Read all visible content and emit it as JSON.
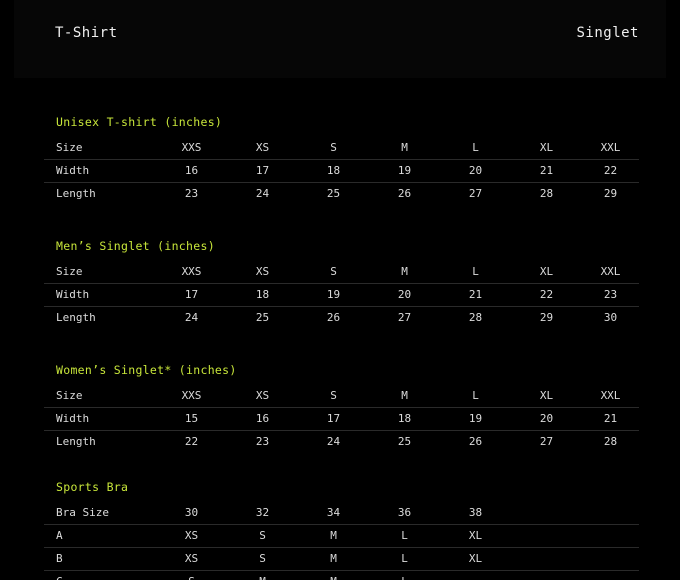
{
  "tabs": {
    "left": "T-Shirt",
    "right": "Singlet"
  },
  "sections": [
    {
      "title": "Unisex T-shirt (inches)",
      "rows": [
        [
          "Size",
          "XXS",
          "XS",
          "S",
          "M",
          "L",
          "XL",
          "XXL"
        ],
        [
          "Width",
          "16",
          "17",
          "18",
          "19",
          "20",
          "21",
          "22"
        ],
        [
          "Length",
          "23",
          "24",
          "25",
          "26",
          "27",
          "28",
          "29"
        ]
      ]
    },
    {
      "title": "Men’s Singlet (inches)",
      "rows": [
        [
          "Size",
          "XXS",
          "XS",
          "S",
          "M",
          "L",
          "XL",
          "XXL"
        ],
        [
          "Width",
          "17",
          "18",
          "19",
          "20",
          "21",
          "22",
          "23"
        ],
        [
          "Length",
          "24",
          "25",
          "26",
          "27",
          "28",
          "29",
          "30"
        ]
      ]
    },
    {
      "title": "Women’s Singlet* (inches)",
      "rows": [
        [
          "Size",
          "XXS",
          "XS",
          "S",
          "M",
          "L",
          "XL",
          "XXL"
        ],
        [
          "Width",
          "15",
          "16",
          "17",
          "18",
          "19",
          "20",
          "21"
        ],
        [
          "Length",
          "22",
          "23",
          "24",
          "25",
          "26",
          "27",
          "28"
        ]
      ]
    },
    {
      "title": "Sports Bra",
      "rows": [
        [
          "Bra Size",
          "30",
          "32",
          "34",
          "36",
          "38",
          "",
          ""
        ],
        [
          "A",
          "XS",
          "S",
          "M",
          "L",
          "XL",
          "",
          ""
        ],
        [
          "B",
          "XS",
          "S",
          "M",
          "L",
          "XL",
          "",
          ""
        ],
        [
          "C",
          "S",
          "M",
          "M",
          "L",
          "",
          "",
          ""
        ]
      ]
    }
  ]
}
